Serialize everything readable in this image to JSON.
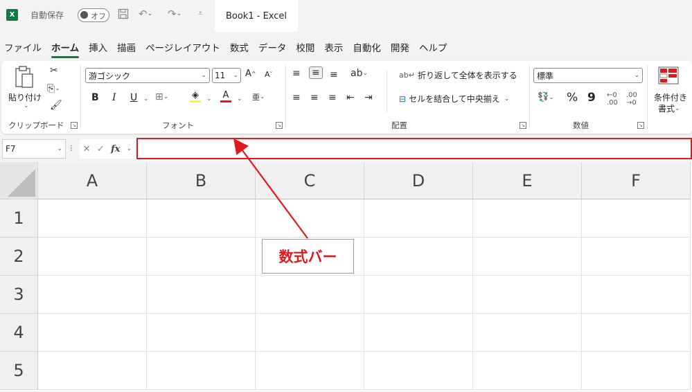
{
  "titlebar": {
    "app_icon": "X",
    "autosave_label": "自動保存",
    "autosave_state": "オフ",
    "document_title": "Book1  -  Excel",
    "icons": [
      "save-icon",
      "undo-icon",
      "redo-icon",
      "customize-icon"
    ]
  },
  "menu": {
    "tabs": [
      "ファイル",
      "ホーム",
      "挿入",
      "描画",
      "ページレイアウト",
      "数式",
      "データ",
      "校閲",
      "表示",
      "自動化",
      "開発",
      "ヘルプ"
    ],
    "active": "ホーム"
  },
  "ribbon": {
    "clipboard": {
      "paste_label": "貼り付け",
      "group_label": "クリップボード"
    },
    "font": {
      "font_name": "游ゴシック",
      "font_size": "11",
      "group_label": "フォント",
      "bold": "B",
      "italic": "I",
      "underline": "U",
      "font_color_glyph": "A"
    },
    "alignment": {
      "wrap_text": "折り返して全体を表示する",
      "merge_center": "セルを結合して中央揃え",
      "group_label": "配置"
    },
    "number": {
      "format": "標準",
      "percent": "%",
      "comma": "9",
      "group_label": "数値"
    },
    "styles": {
      "conditional_format_line1": "条件付き",
      "conditional_format_line2": "書式"
    }
  },
  "formula_bar": {
    "name_box": "F7",
    "fx_label": "fx",
    "value": ""
  },
  "grid": {
    "columns": [
      "A",
      "B",
      "C",
      "D",
      "E",
      "F"
    ],
    "rows": [
      "1",
      "2",
      "3",
      "4",
      "5"
    ]
  },
  "annotation": {
    "label": "数式バー",
    "color": "#e0191e"
  },
  "colors": {
    "excel_green": "#107c41",
    "highlight_red": "#e0191e"
  }
}
